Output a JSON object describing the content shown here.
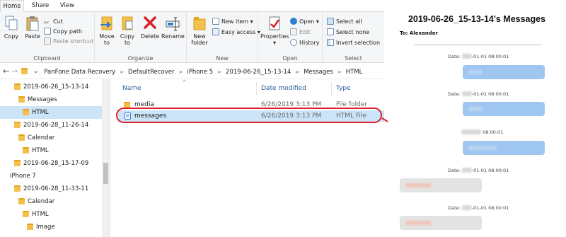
{
  "tabs": [
    "Home",
    "Share",
    "View"
  ],
  "ribbon": {
    "clipboard": {
      "label": "Clipboard",
      "copy": "Copy",
      "paste": "Paste",
      "cut": "Cut",
      "copy_path": "Copy path",
      "paste_shortcut": "Paste shortcut"
    },
    "organize": {
      "label": "Organize",
      "move_to": [
        "Move",
        "to"
      ],
      "copy_to": [
        "Copy",
        "to"
      ],
      "delete": "Delete",
      "rename": "Rename"
    },
    "new": {
      "label": "New",
      "new_folder": [
        "New",
        "folder"
      ],
      "new_item": "New item",
      "easy_access": "Easy access"
    },
    "open": {
      "label": "Open",
      "properties": "Properties",
      "open": "Open",
      "edit": "Edit",
      "history": "History"
    },
    "select": {
      "label": "Select",
      "select_all": "Select all",
      "select_none": "Select none",
      "invert_selection": "Invert selection"
    }
  },
  "breadcrumbs": [
    "PanFone Data Recovery",
    "DefaultRecover",
    "iPhone 5",
    "2019-06-26_15-13-14",
    "Messages",
    "HTML"
  ],
  "nav_items": [
    {
      "label": "2019-06-26_15-13-14"
    },
    {
      "label": "Messages"
    },
    {
      "label": "HTML"
    },
    {
      "label": "2019-06-28_11-26-14"
    },
    {
      "label": "Calendar"
    },
    {
      "label": "HTML"
    },
    {
      "label": "2019-06-28_15-17-09"
    },
    {
      "label": "iPhone 7"
    },
    {
      "label": "2019-06-28_11-33-11"
    },
    {
      "label": "Calendar"
    },
    {
      "label": "HTML"
    },
    {
      "label": "Image"
    }
  ],
  "columns": [
    "Name",
    "Date modified",
    "Type"
  ],
  "files": [
    {
      "name": "media",
      "date": "6/26/2019 3:13 PM",
      "type": "File folder"
    },
    {
      "name": "messages",
      "date": "6/26/2019 3:13 PM",
      "type": "HTML File"
    }
  ],
  "preview": {
    "title": "2019-06-26_15-13-14's Messages",
    "to": "To: Alexander",
    "dates": [
      {
        "prefix": "Date:",
        "suffix": "-01-01 08:00:01"
      },
      {
        "prefix": "Date:",
        "suffix": "-01-01 08:00:01"
      },
      {
        "prefix": "",
        "suffix": "08:00:01"
      },
      {
        "prefix": "Date:",
        "suffix": "-01-01 08:00:01"
      },
      {
        "prefix": "Date:",
        "suffix": "-01-01 08:00:01"
      }
    ]
  },
  "colors": {
    "selection": "#cce4f7",
    "highlight_ring": "#e0202a",
    "sent_bubble": "#9fc6f0",
    "received_bubble": "#e3e3e3",
    "folder": "#f3c14b"
  }
}
